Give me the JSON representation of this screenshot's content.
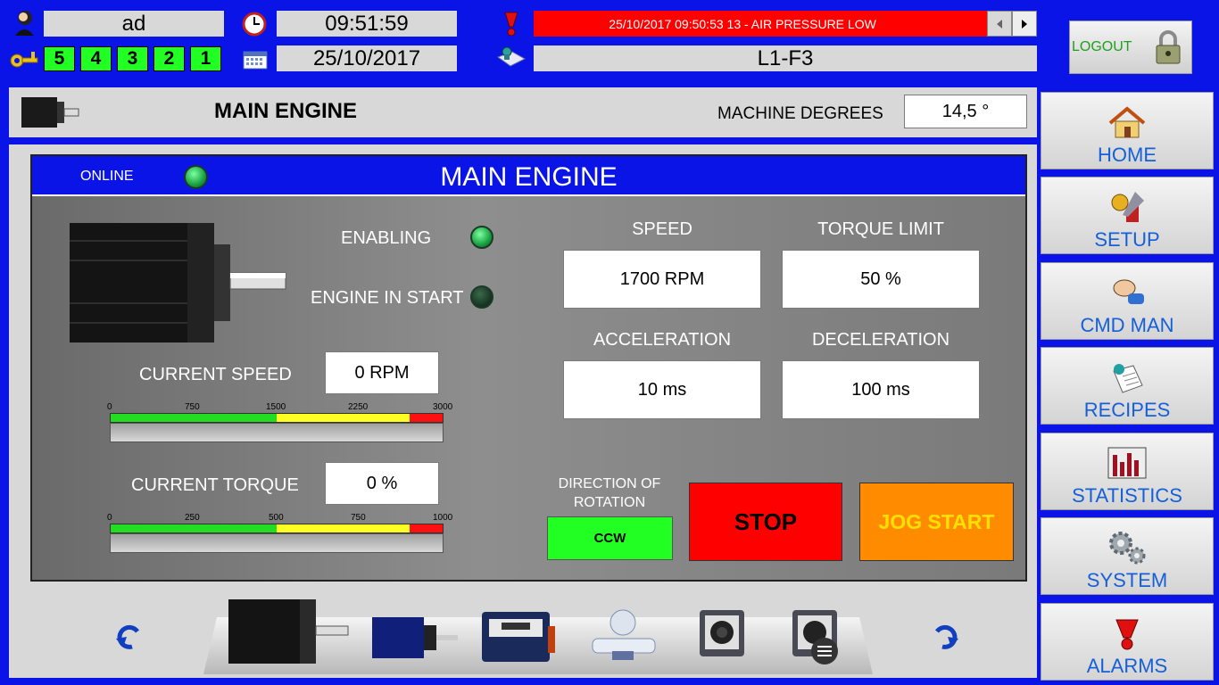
{
  "header": {
    "user": "ad",
    "time": "09:51:59",
    "date": "25/10/2017",
    "levels": [
      "5",
      "4",
      "3",
      "2",
      "1"
    ],
    "alarm_message": "25/10/2017 09:50:53 13 - AIR PRESSURE LOW",
    "line": "L1-F3",
    "logout_label": "LOGOUT"
  },
  "page": {
    "title": "MAIN ENGINE",
    "degrees_label": "MACHINE DEGREES",
    "degrees_value": "14,5 °"
  },
  "panel": {
    "status": "ONLINE",
    "title": "MAIN ENGINE",
    "enabling_label": "ENABLING",
    "engine_start_label": "ENGINE IN START",
    "current_speed_label": "CURRENT SPEED",
    "current_speed_value": "0 RPM",
    "current_torque_label": "CURRENT TORQUE",
    "current_torque_value": "0 %",
    "speed_scale": [
      "0",
      "750",
      "1500",
      "2250",
      "3000"
    ],
    "torque_scale": [
      "0",
      "250",
      "500",
      "750",
      "1000"
    ],
    "speed_label": "SPEED",
    "speed_value": "1700 RPM",
    "torque_limit_label": "TORQUE LIMIT",
    "torque_limit_value": "50 %",
    "acceleration_label": "ACCELERATION",
    "acceleration_value": "10 ms",
    "deceleration_label": "DECELERATION",
    "deceleration_value": "100 ms",
    "direction_label": "DIRECTION OF ROTATION",
    "direction_value": "CCW",
    "stop_label": "STOP",
    "jog_label": "JOG START",
    "current_speed_fraction": 0,
    "current_torque_fraction": 0
  },
  "nav": [
    {
      "label": "HOME",
      "icon": "home-icon"
    },
    {
      "label": "SETUP",
      "icon": "setup-icon"
    },
    {
      "label": "CMD MAN",
      "icon": "hand-icon"
    },
    {
      "label": "RECIPES",
      "icon": "recipes-icon"
    },
    {
      "label": "STATISTICS",
      "icon": "statistics-icon"
    },
    {
      "label": "SYSTEM",
      "icon": "gears-icon"
    },
    {
      "label": "ALARMS",
      "icon": "alarm-icon"
    }
  ],
  "colors": {
    "frame": "#0a14e6",
    "green": "#22ff22",
    "stop": "#ff0000",
    "jog": "#ff8c00",
    "alarm": "#ff0000"
  }
}
